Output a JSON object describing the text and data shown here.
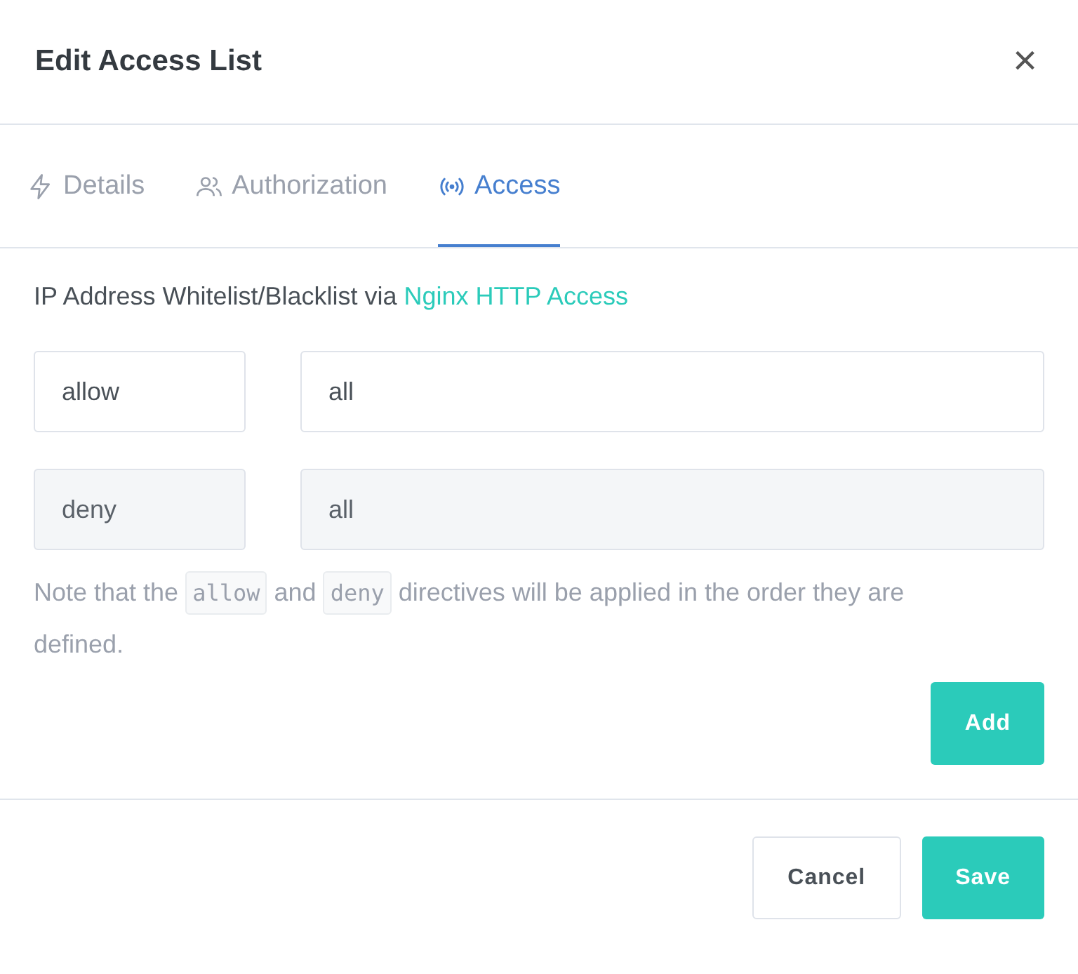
{
  "dialog": {
    "title": "Edit Access List",
    "close_label": "×"
  },
  "tabs": [
    {
      "label": "Details",
      "selected": false
    },
    {
      "label": "Authorization",
      "selected": false
    },
    {
      "label": "Access",
      "selected": true
    }
  ],
  "intro": {
    "text": "IP Address Whitelist/Blacklist via",
    "link": "Nginx HTTP Access"
  },
  "rules": [
    {
      "directive": "allow",
      "address": "all",
      "disabled": false
    },
    {
      "directive": "deny",
      "address": "all",
      "disabled": true
    }
  ],
  "note": [
    {
      "kind": "text",
      "text": "Note that the"
    },
    {
      "kind": "code",
      "text": "allow"
    },
    {
      "kind": "text",
      "text": "and"
    },
    {
      "kind": "code",
      "text": "deny"
    },
    {
      "kind": "text",
      "text": "directives will be applied in the order they are defined."
    }
  ],
  "add_button": "Add",
  "footer_buttons": [
    {
      "label": "Cancel",
      "kind": "secondary"
    },
    {
      "label": "Save",
      "kind": "primary"
    }
  ]
}
